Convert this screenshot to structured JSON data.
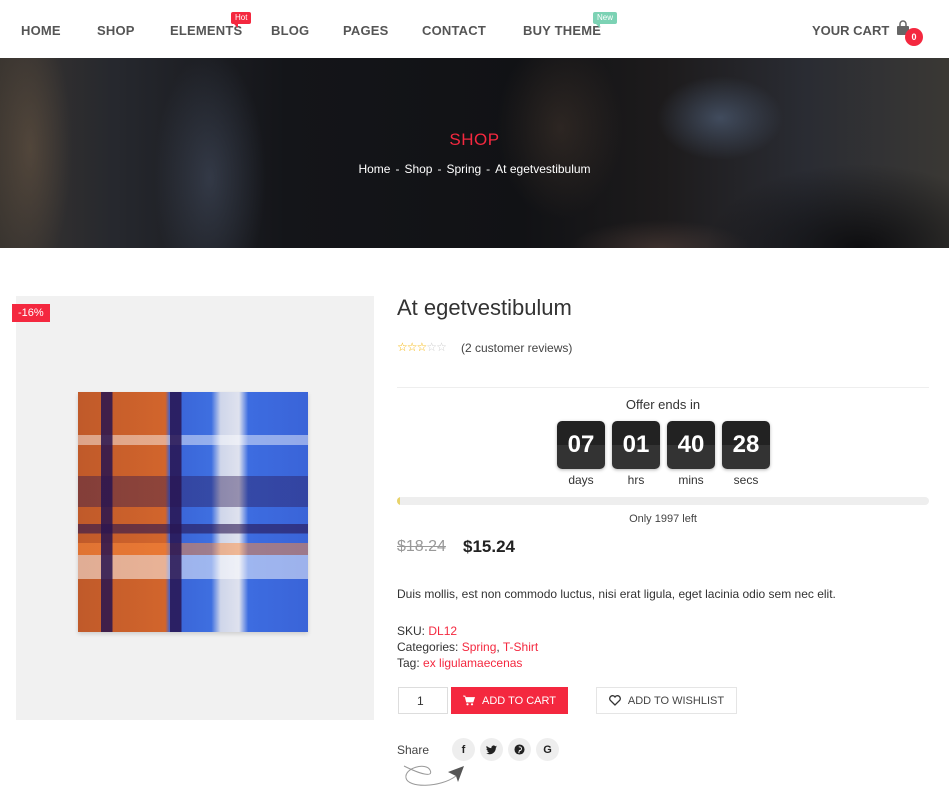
{
  "nav": {
    "items": [
      {
        "label": "HOME"
      },
      {
        "label": "SHOP"
      },
      {
        "label": "ELEMENTS",
        "badge": "Hot"
      },
      {
        "label": "BLOG"
      },
      {
        "label": "PAGES"
      },
      {
        "label": "CONTACT"
      },
      {
        "label": "BUY THEME",
        "badge": "New"
      }
    ],
    "cart_label": "YOUR CART",
    "cart_count": "0",
    "cart_icon": "shopping-bag-icon"
  },
  "hero": {
    "title": "SHOP",
    "breadcrumb": [
      "Home",
      "Shop",
      "Spring",
      "At egetvestibulum"
    ],
    "separator": "-"
  },
  "product": {
    "sale_badge": "-16%",
    "title": "At egetvestibulum",
    "rating": 3,
    "rating_max": 5,
    "reviews": "(2 customer reviews)",
    "offer_label": "Offer ends in",
    "countdown": [
      {
        "value": "07",
        "unit": "days"
      },
      {
        "value": "01",
        "unit": "hrs"
      },
      {
        "value": "40",
        "unit": "mins"
      },
      {
        "value": "28",
        "unit": "secs"
      }
    ],
    "stock_progress_percent": 0.5,
    "stock_text": "Only 1997 left",
    "old_price": "$18.24",
    "price": "$15.24",
    "description": "Duis mollis, est non commodo luctus, nisi erat ligula, eget lacinia odio sem nec elit.",
    "sku_label": "SKU:",
    "sku": "DL12",
    "categories_label": "Categories:",
    "categories": [
      "Spring",
      "T-Shirt"
    ],
    "tag_label": "Tag:",
    "tag": "ex ligulamaecenas",
    "quantity": "1",
    "add_to_cart": "ADD TO CART",
    "add_to_wishlist": "ADD TO WISHLIST",
    "share_label": "Share",
    "social": [
      {
        "icon": "facebook-icon",
        "glyph": "f"
      },
      {
        "icon": "twitter-icon",
        "glyph": "t"
      },
      {
        "icon": "pinterest-icon",
        "glyph": "p"
      },
      {
        "icon": "google-icon",
        "glyph": "G"
      }
    ]
  },
  "colors": {
    "accent": "#f4283f",
    "badge_new": "#7cd2b4",
    "star": "#f5b301"
  }
}
